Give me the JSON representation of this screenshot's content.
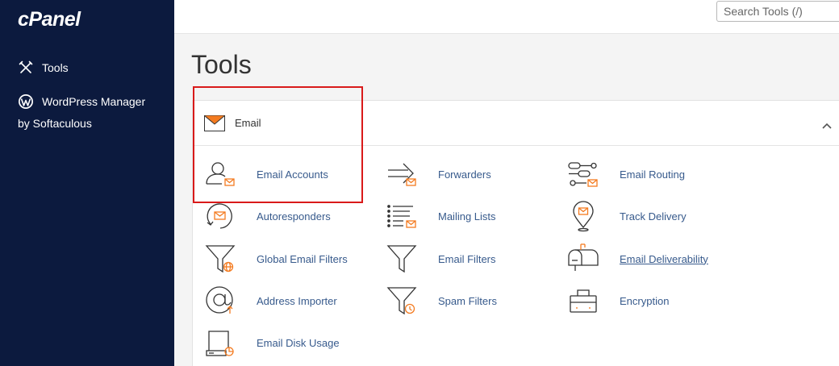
{
  "sidebar": {
    "logo": "cPanel",
    "items": [
      {
        "label": "Tools"
      },
      {
        "label": "WordPress Manager",
        "sub": "by Softaculous"
      }
    ]
  },
  "search": {
    "placeholder": "Search Tools (/)"
  },
  "page": {
    "title": "Tools"
  },
  "panel": {
    "title": "Email",
    "tools": [
      {
        "label": "Email Accounts",
        "icon": "email-accounts-icon"
      },
      {
        "label": "Forwarders",
        "icon": "forwarders-icon"
      },
      {
        "label": "Email Routing",
        "icon": "email-routing-icon"
      },
      {
        "label": "Autoresponders",
        "icon": "autoresponders-icon"
      },
      {
        "label": "Mailing Lists",
        "icon": "mailing-lists-icon"
      },
      {
        "label": "Track Delivery",
        "icon": "track-delivery-icon"
      },
      {
        "label": "Global Email Filters",
        "icon": "global-email-filters-icon"
      },
      {
        "label": "Email Filters",
        "icon": "email-filters-icon"
      },
      {
        "label": "Email Deliverability",
        "icon": "email-deliverability-icon"
      },
      {
        "label": "Address Importer",
        "icon": "address-importer-icon"
      },
      {
        "label": "Spam Filters",
        "icon": "spam-filters-icon"
      },
      {
        "label": "Encryption",
        "icon": "encryption-icon"
      },
      {
        "label": "Email Disk Usage",
        "icon": "email-disk-usage-icon"
      }
    ]
  },
  "colors": {
    "sidebar": "#0c1a3e",
    "accent": "#f47b20",
    "link": "#375a8c",
    "highlight": "#d91a1a"
  }
}
